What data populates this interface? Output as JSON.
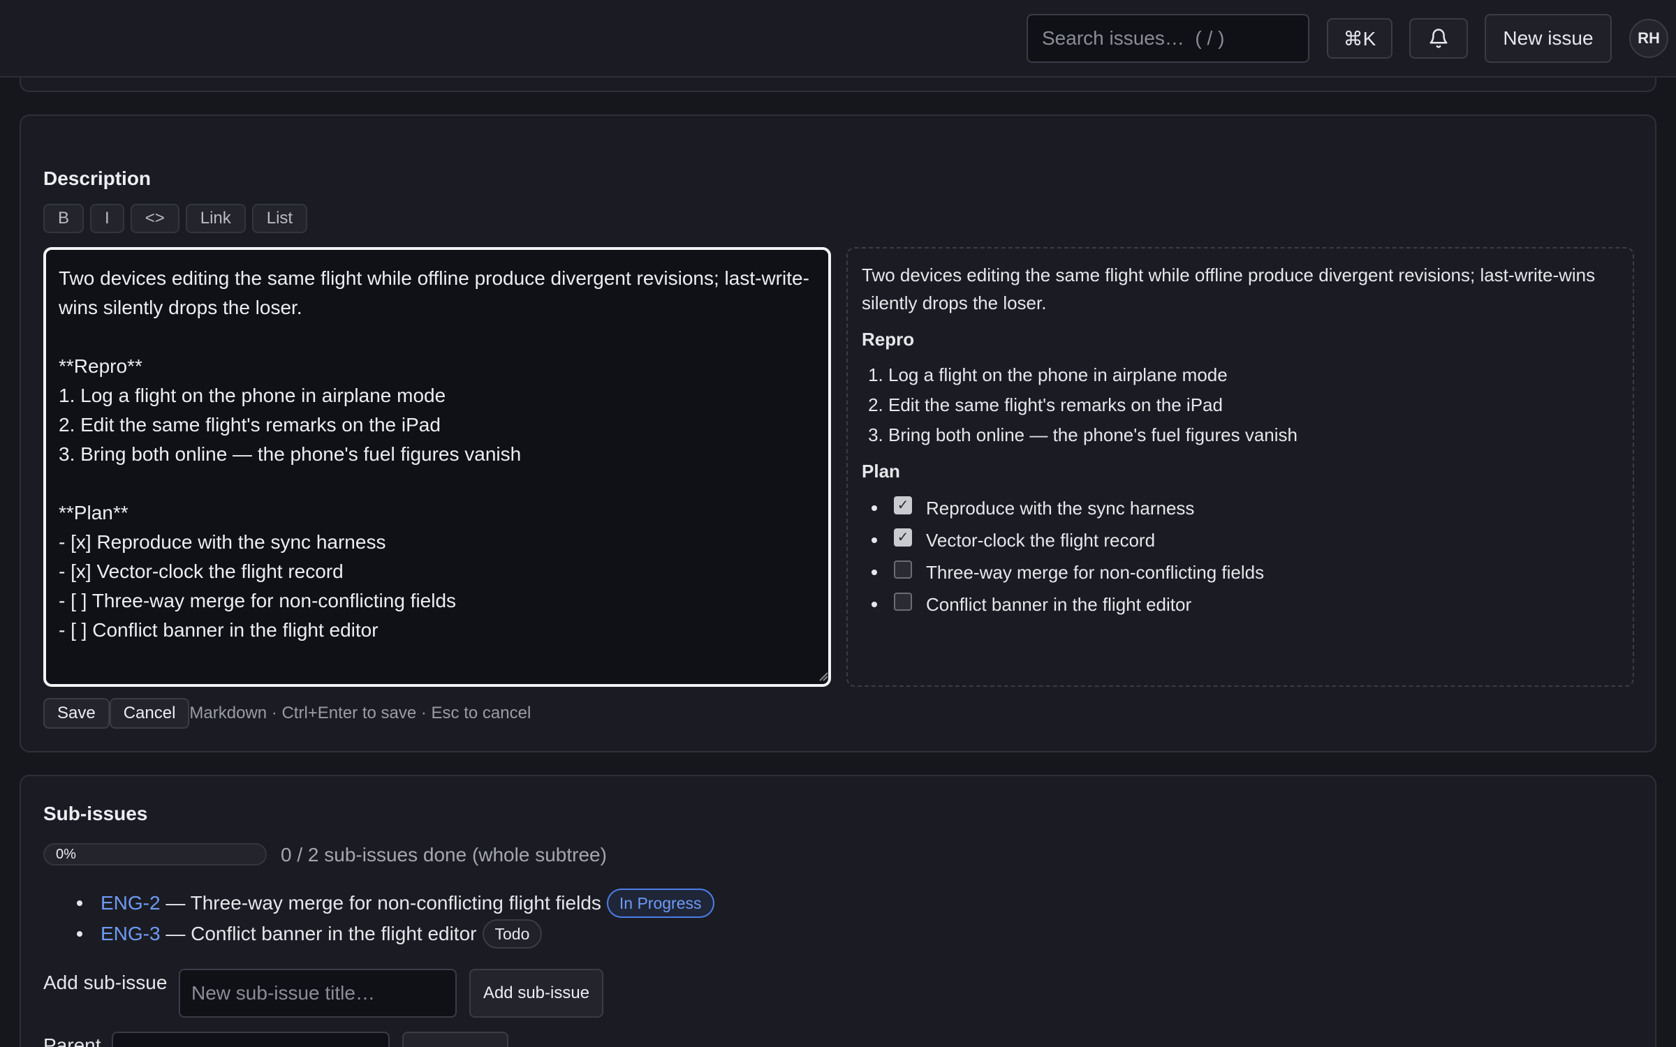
{
  "header": {
    "search_placeholder": "Search issues…  ( / )",
    "command_label": "⌘K",
    "bell_icon": "bell-icon",
    "new_issue_label": "New issue",
    "avatar_initials": "RH"
  },
  "description": {
    "title": "Description",
    "toolbar": [
      "B",
      "I",
      "<>",
      "Link",
      "List"
    ],
    "editor_text": "Two devices editing the same flight while offline produce divergent revisions; last-write-wins silently drops the loser.\n\n**Repro**\n1. Log a flight on the phone in airplane mode\n2. Edit the same flight's remarks on the iPad\n3. Bring both online — the phone's fuel figures vanish\n\n**Plan**\n- [x] Reproduce with the sync harness\n- [x] Vector-clock the flight record\n- [ ] Three-way merge for non-conflicting fields\n- [ ] Conflict banner in the flight editor",
    "preview": {
      "intro": "Two devices editing the same flight while offline produce divergent revisions; last-write-wins silently drops the loser.",
      "repro_heading": "Repro",
      "repro_steps": [
        "Log a flight on the phone in airplane mode",
        "Edit the same flight's remarks on the iPad",
        "Bring both online — the phone's fuel figures vanish"
      ],
      "plan_heading": "Plan",
      "plan_items": [
        {
          "text": "Reproduce with the sync harness",
          "checked": true
        },
        {
          "text": "Vector-clock the flight record",
          "checked": true
        },
        {
          "text": "Three-way merge for non-conflicting fields",
          "checked": false
        },
        {
          "text": "Conflict banner in the flight editor",
          "checked": false
        }
      ]
    },
    "save_label": "Save",
    "cancel_label": "Cancel",
    "hint": "Markdown · Ctrl+Enter to save · Esc to cancel"
  },
  "subissues": {
    "title": "Sub-issues",
    "progress_label": "0%",
    "progress_value": 0,
    "progress_text": "0 / 2 sub-issues done (whole subtree)",
    "items": [
      {
        "key": "ENG-2",
        "title": " — Three-way merge for non-conflicting flight fields",
        "status": "In Progress"
      },
      {
        "key": "ENG-3",
        "title": " — Conflict banner in the flight editor",
        "status": "Todo"
      }
    ],
    "add_label": "Add sub-issue",
    "add_placeholder": "New sub-issue title…",
    "add_button": "Add sub-issue",
    "parent_label": "Parent"
  },
  "colors": {
    "accent": "#4c7fe8",
    "link": "#6e9bf5",
    "background": "#16171d",
    "card": "#1b1c23"
  }
}
